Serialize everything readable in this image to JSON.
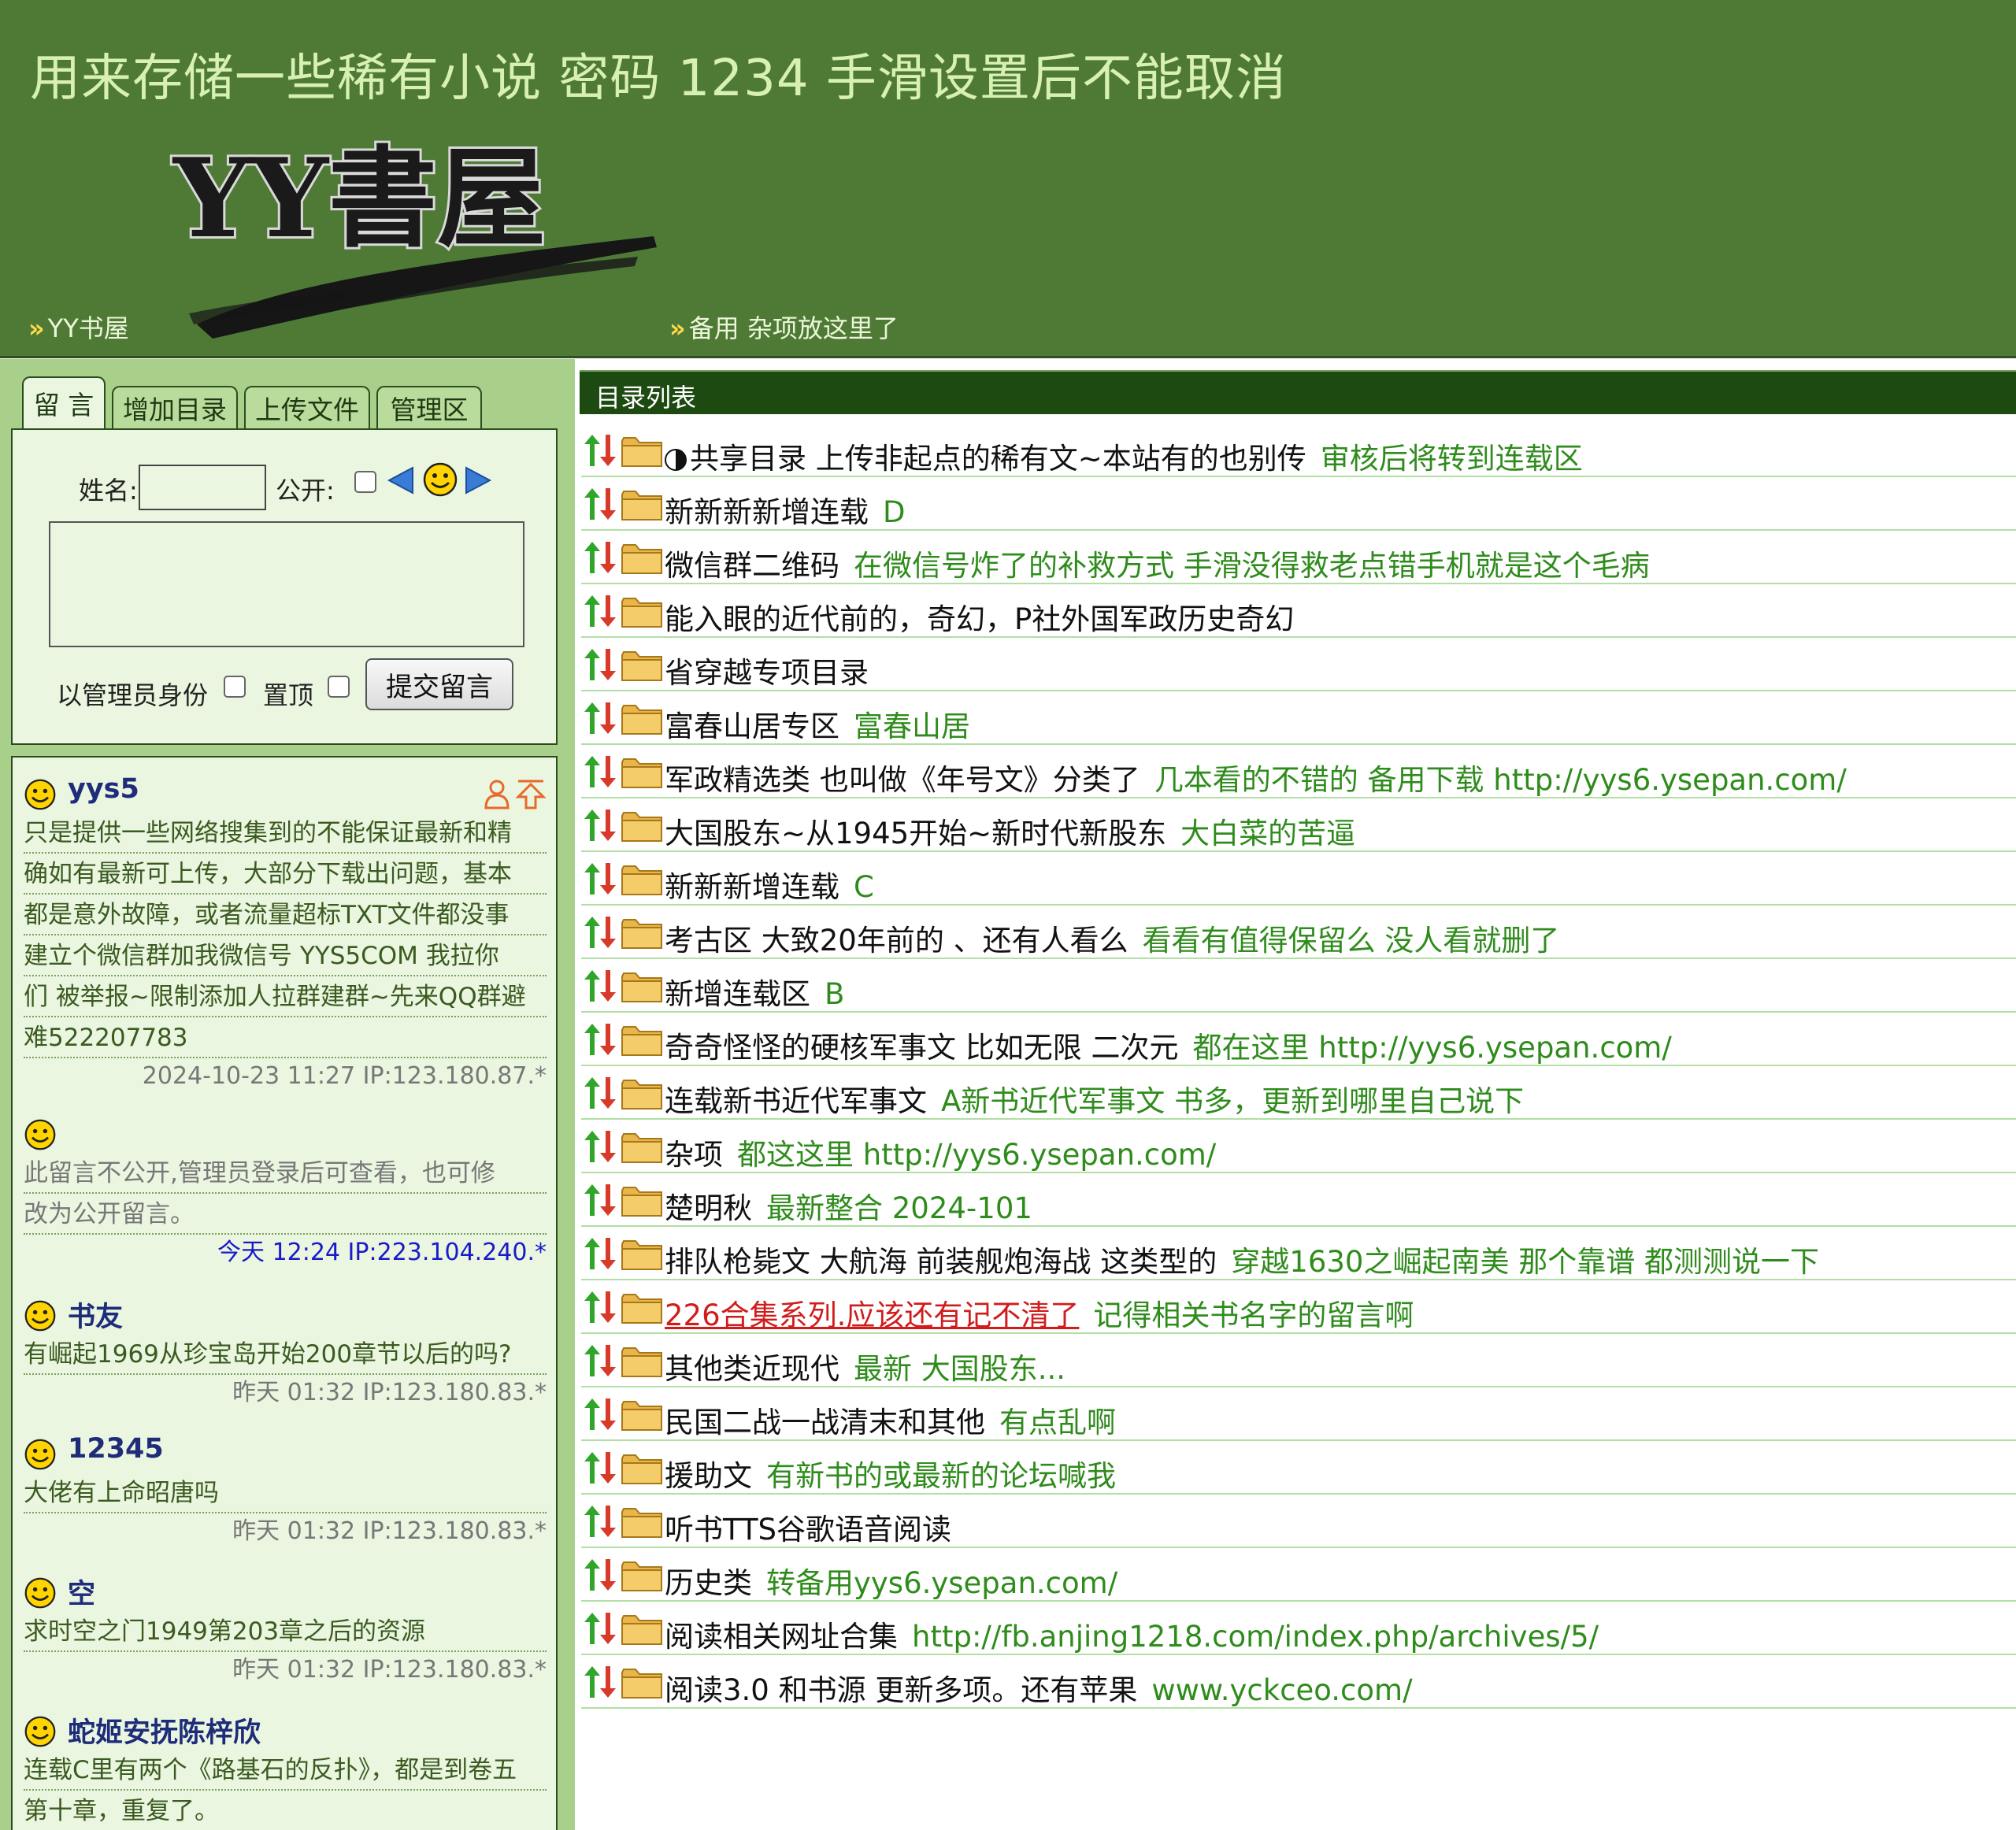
{
  "header": {
    "title": "用来存储一些稀有小说 密码 1234 手滑设置后不能取消",
    "logo_text": "YY書屋",
    "nav": [
      {
        "arrow": "»",
        "label": "YY书屋"
      },
      {
        "arrow": "»",
        "label": "备用 杂项放这里了"
      }
    ]
  },
  "left_panel": {
    "tabs": [
      "留 言",
      "增加目录",
      "上传文件",
      "管理区"
    ],
    "active_tab": "留 言",
    "form": {
      "name_label": "姓名:",
      "name_value": "",
      "public_label": "公开:",
      "message_value": "",
      "admin_label": "以管理员身份",
      "top_label": "置顶",
      "submit_label": "提交留言"
    },
    "messages": [
      {
        "author": "yys5",
        "lines": [
          "只是提供一些网络搜集到的不能保证最新和精",
          "确如有最新可上传，大部分下载出问题，基本",
          "都是意外故障，或者流量超标TXT文件都没事",
          "建立个微信群加我微信号 YYS5COM 我拉你",
          "们 被举报~限制添加人拉群建群~先来QQ群避",
          "难522207783"
        ],
        "meta": "2024-10-23 11:27 IP:123.180.87.*"
      },
      {
        "author": "",
        "lines": [
          "此留言不公开,管理员登录后可查看，也可修",
          "改为公开留言。"
        ],
        "meta": "今天 12:24 IP:223.104.240.*"
      },
      {
        "author": "书友",
        "lines": [
          "有崛起1969从珍宝岛开始200章节以后的吗?"
        ],
        "meta": "昨天 01:32 IP:123.180.83.*"
      },
      {
        "author": "12345",
        "lines": [
          "大佬有上命昭唐吗"
        ],
        "meta": "昨天 01:32 IP:123.180.83.*"
      },
      {
        "author": "空",
        "lines": [
          "求时空之门1949第203章之后的资源"
        ],
        "meta": "昨天 01:32 IP:123.180.83.*"
      },
      {
        "author": "蛇姬安抚陈梓欣",
        "lines": [
          "连载C里有两个《路基石的反扑》，都是到卷五",
          "第十章，重复了。"
        ],
        "meta": ""
      }
    ]
  },
  "right_panel": {
    "title": "目录列表",
    "rows": [
      {
        "name": "共享目录 上传非起点的稀有文~本站有的也别传",
        "comment": "审核后将转到连载区"
      },
      {
        "name": "新新新新增连载",
        "comment": "D"
      },
      {
        "name": "微信群二维码",
        "comment": "在微信号炸了的补救方式 手滑没得救老点错手机就是这个毛病"
      },
      {
        "name": "能入眼的近代前的，奇幻，P社外国军政历史奇幻",
        "comment": ""
      },
      {
        "name": "省穿越专项目录",
        "comment": ""
      },
      {
        "name": "富春山居专区",
        "comment": "富春山居"
      },
      {
        "name": "军政精选类 也叫做《年号文》分类了",
        "comment": "几本看的不错的 备用下载 http://yys6.ysepan.com/"
      },
      {
        "name": "大国股东~从1945开始~新时代新股东",
        "comment": "大白菜的苦逼"
      },
      {
        "name": "新新新增连载",
        "comment": "C"
      },
      {
        "name": "考古区 大致20年前的 、还有人看么",
        "comment": "看看有值得保留么 没人看就删了"
      },
      {
        "name": "新增连载区",
        "comment": "B"
      },
      {
        "name": "奇奇怪怪的硬核军事文 比如无限 二次元",
        "comment": "都在这里 http://yys6.ysepan.com/"
      },
      {
        "name": "连载新书近代军事文",
        "comment": "A新书近代军事文 书多，更新到哪里自己说下"
      },
      {
        "name": "杂项",
        "comment": "都这这里 http://yys6.ysepan.com/"
      },
      {
        "name": "楚明秋",
        "comment": "最新整合 2024-101"
      },
      {
        "name": "排队枪毙文 大航海 前装舰炮海战 这类型的",
        "comment": "穿越1630之崛起南美 那个靠谱 都测测说一下"
      },
      {
        "name": "226合集系列.应该还有记不清了",
        "comment": "记得相关书名字的留言啊"
      },
      {
        "name": "其他类近现代",
        "comment": "最新 大国股东..."
      },
      {
        "name": "民国二战一战清末和其他",
        "comment": "有点乱啊"
      },
      {
        "name": "援助文",
        "comment": "有新书的或最新的论坛喊我"
      },
      {
        "name": "听书TTS谷歌语音阅读",
        "comment": ""
      },
      {
        "name": "历史类",
        "comment": "转备用yys6.ysepan.com/"
      },
      {
        "name": "阅读相关网址合集",
        "comment": "http://fb.anjing1218.com/index.php/archives/5/"
      },
      {
        "name": "阅读3.0 和书源 更新多项。还有苹果",
        "comment": "www.yckceo.com/"
      }
    ]
  },
  "colors": {
    "header_bg": "#4e7a36",
    "panel_green": "#a8d08a",
    "comment_green": "#2f8c1c",
    "link_red": "#d11c1c",
    "list_header": "#1d4a10"
  }
}
